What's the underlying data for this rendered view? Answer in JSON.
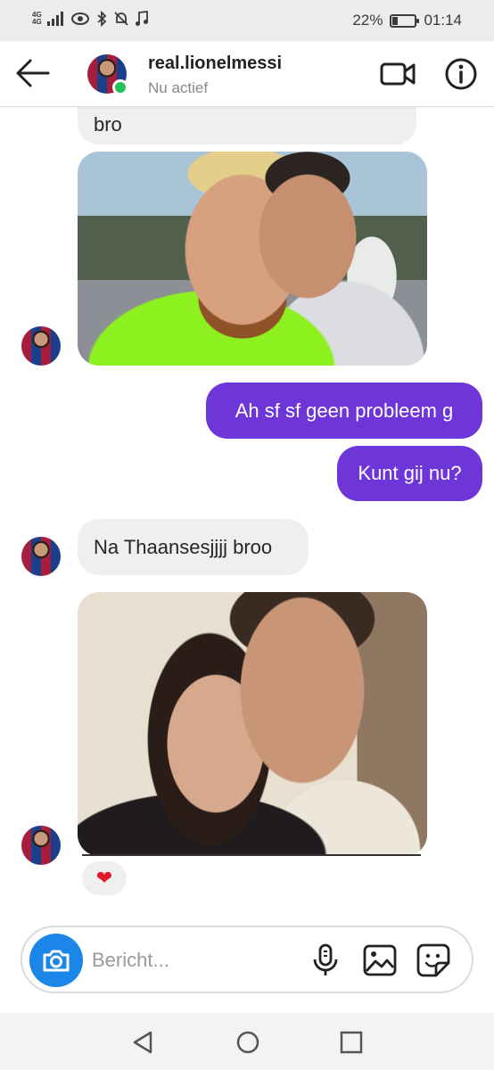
{
  "status_bar": {
    "network_top": "4G",
    "network_bottom": "4G",
    "battery": "22%",
    "battery_level": 0.22,
    "time": "01:14"
  },
  "header": {
    "username": "real.lionelmessi",
    "status": "Nu actief"
  },
  "messages": {
    "incoming_1": "bro",
    "outgoing_1": "Ah sf sf geen probleem g",
    "outgoing_2": "Kunt gij nu?",
    "incoming_2": "Na Thaansesjjjj broo",
    "reaction": "❤"
  },
  "composer": {
    "placeholder": "Bericht..."
  },
  "colors": {
    "outgoing_bubble": "#6e35d8",
    "incoming_bubble": "#efefef",
    "camera_button": "#1c86e8",
    "online": "#1fc35a",
    "reaction_heart": "#e0162b"
  },
  "icons": [
    "back-arrow-icon",
    "video-call-icon",
    "info-icon",
    "camera-icon",
    "microphone-icon",
    "gallery-icon",
    "sticker-icon",
    "nav-back-icon",
    "nav-home-icon",
    "nav-recent-icon"
  ]
}
